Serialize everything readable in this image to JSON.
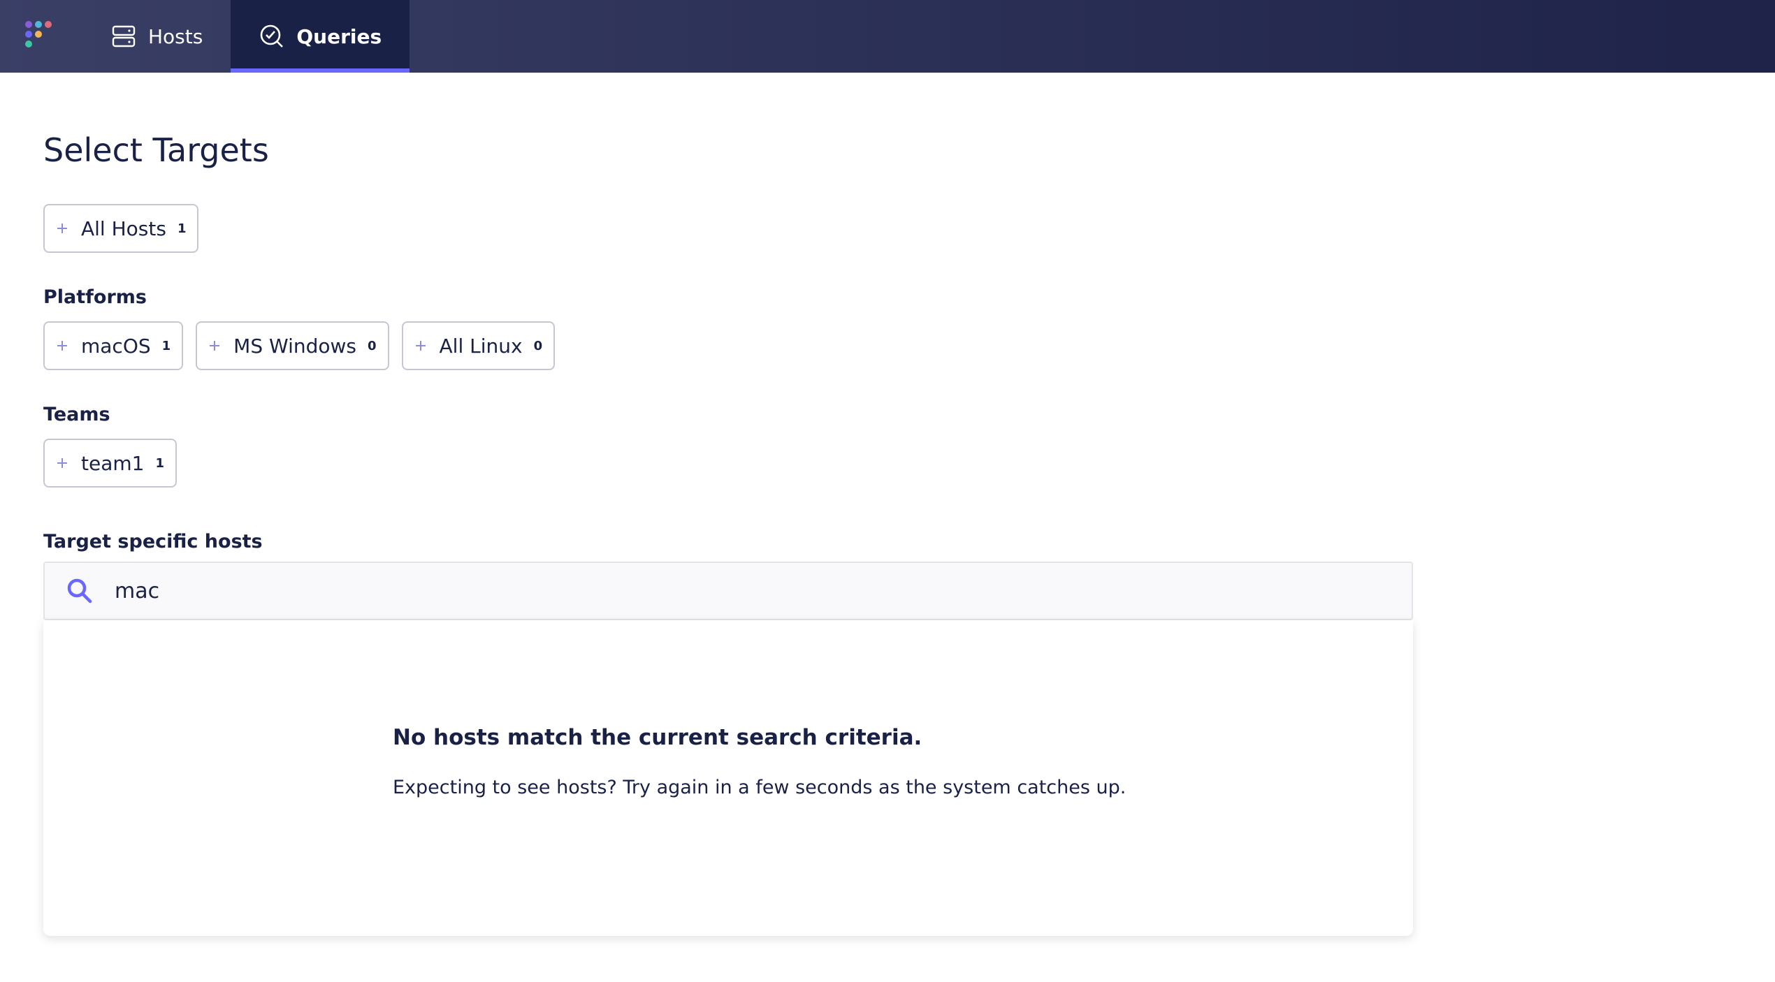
{
  "nav": {
    "items": [
      {
        "label": "Hosts",
        "icon": "hosts-icon",
        "active": false
      },
      {
        "label": "Queries",
        "icon": "queries-icon",
        "active": true
      }
    ],
    "accent": "#6a67fe"
  },
  "page": {
    "title": "Select Targets"
  },
  "all_hosts": {
    "label": "All Hosts",
    "count": "1"
  },
  "platforms": {
    "label": "Platforms",
    "items": [
      {
        "label": "macOS",
        "count": "1"
      },
      {
        "label": "MS Windows",
        "count": "0"
      },
      {
        "label": "All Linux",
        "count": "0"
      }
    ]
  },
  "teams": {
    "label": "Teams",
    "items": [
      {
        "label": "team1",
        "count": "1"
      }
    ]
  },
  "target_hosts": {
    "label": "Target specific hosts",
    "search_value": "mac",
    "empty_title": "No hosts match the current search criteria.",
    "empty_text": "Expecting to see hosts? Try again in a few seconds as the system catches up."
  }
}
